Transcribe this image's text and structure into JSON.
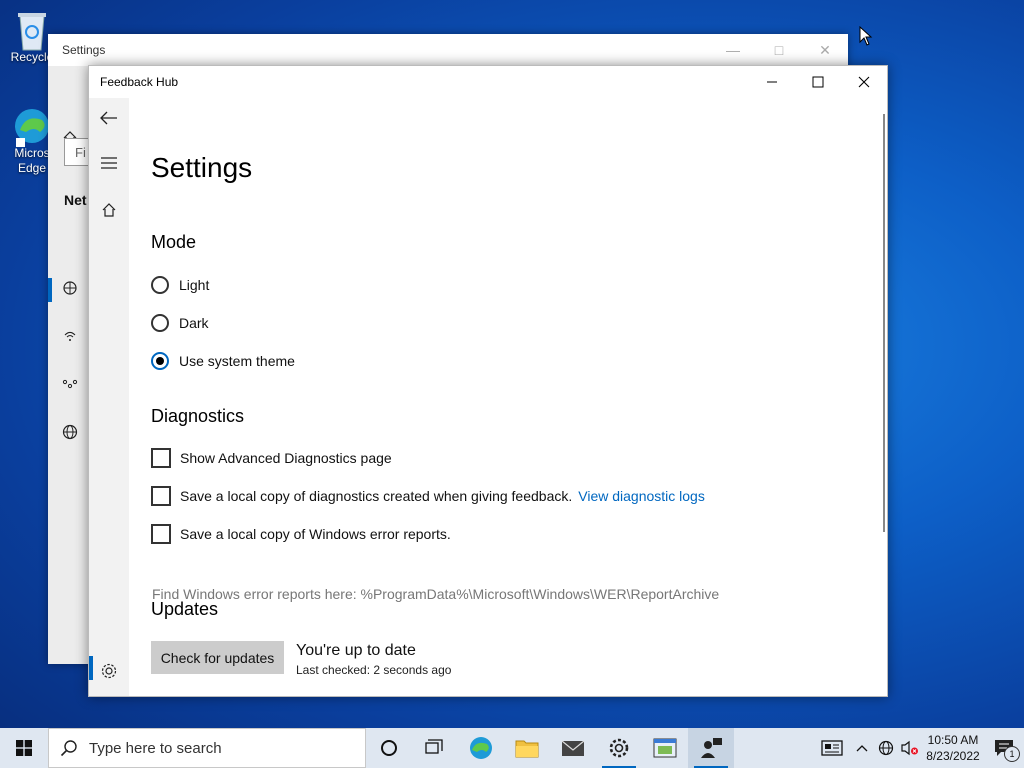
{
  "desktop": {
    "icons": [
      {
        "label": "Recycle",
        "name": "recycle-bin"
      },
      {
        "label": "Micros Edge",
        "name": "microsoft-edge"
      }
    ]
  },
  "settings_window": {
    "title": "Settings",
    "find_placeholder": "Fi",
    "section_partial": "Net"
  },
  "feedback_hub": {
    "window_title": "Feedback Hub",
    "page_title": "Settings",
    "mode": {
      "heading": "Mode",
      "options": [
        "Light",
        "Dark",
        "Use system theme"
      ],
      "selected": "Use system theme"
    },
    "diagnostics": {
      "heading": "Diagnostics",
      "show_advanced": "Show Advanced Diagnostics page",
      "save_diag": "Save a local copy of diagnostics created when giving feedback.",
      "view_logs_link": "View diagnostic logs",
      "save_errors": "Save a local copy of Windows error reports.",
      "hint": "Find Windows error reports here: %ProgramData%\\Microsoft\\Windows\\WER\\ReportArchive"
    },
    "updates": {
      "heading": "Updates",
      "button": "Check for updates",
      "status": "You're up to date",
      "last_checked": "Last checked: 2 seconds ago"
    }
  },
  "taskbar": {
    "search_placeholder": "Type here to search",
    "time": "10:50 AM",
    "date": "8/23/2022",
    "notification_count": "1"
  },
  "colors": {
    "accent": "#0067c0",
    "taskbar": "#dfe7f1"
  }
}
